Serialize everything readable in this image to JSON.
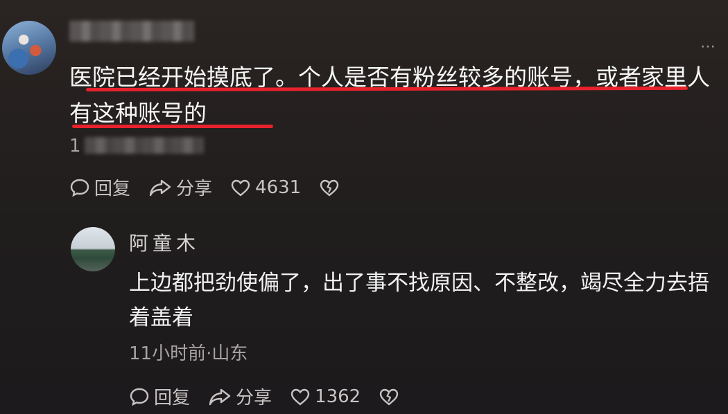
{
  "main_comment": {
    "text": "医院已经开始摸底了。个人是否有粉丝较多的账号，或者家里人有这种账号的",
    "meta_visible": "1",
    "actions": {
      "reply_label": "回复",
      "share_label": "分享",
      "like_count": "4631"
    }
  },
  "reply_comment": {
    "author": "阿童木",
    "text": "上边都把劲使偏了，出了事不找原因、不整改，竭尽全力去捂着盖着",
    "meta": "11小时前·山东",
    "actions": {
      "reply_label": "回复",
      "share_label": "分享",
      "like_count": "1362"
    }
  },
  "icons": {
    "more": "more-dots-icon",
    "reply": "comment-bubble-icon",
    "share": "share-arrow-icon",
    "like": "heart-icon",
    "dislike": "broken-heart-icon"
  },
  "colors": {
    "highlight_underline": "#e8222c",
    "text_primary": "#f7f7f7",
    "text_secondary": "#a9a4a4"
  }
}
